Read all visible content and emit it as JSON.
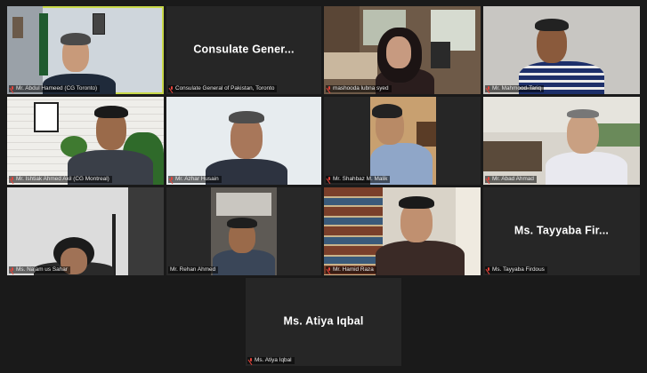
{
  "participants": [
    {
      "id": "p1",
      "label": "Mr. Abdul Hameed (CG Toronto)",
      "muted": true,
      "speaking": true
    },
    {
      "id": "p2",
      "label": "Consulate General of Pakistan, Toronto",
      "display": "Consulate  Gener...",
      "muted": true
    },
    {
      "id": "p3",
      "label": "mashooda lubna syed",
      "muted": true
    },
    {
      "id": "p4",
      "label": "Mr. Mahmood-Tariq",
      "muted": true
    },
    {
      "id": "p5",
      "label": "Mr. Ishtiak Ahmed Akil  (CG Montreal)",
      "muted": true
    },
    {
      "id": "p6",
      "label": "Mr. Azhar Husain",
      "muted": true
    },
    {
      "id": "p7",
      "label": "Mr. Shahbaz M. Malik",
      "muted": true
    },
    {
      "id": "p8",
      "label": "Mr. Abad Ahmad",
      "muted": true
    },
    {
      "id": "p9",
      "label": "Ms. Najam us Sahar",
      "muted": true
    },
    {
      "id": "p10",
      "label": "Mr. Rehan Ahmed",
      "muted": false
    },
    {
      "id": "p11",
      "label": "Mr. Hamid Raza",
      "muted": true
    },
    {
      "id": "p12",
      "label": "Ms. Tayyaba Firdous",
      "display": "Ms. Tayyaba Fir...",
      "muted": true
    },
    {
      "id": "p13",
      "label": "Ms. Atiya Iqbal",
      "display": "Ms. Atiya Iqbal",
      "muted": true
    }
  ],
  "colors": {
    "background": "#1a1a1a",
    "speaker_outline": "#c9d94a",
    "muted_icon": "#e5433a"
  }
}
